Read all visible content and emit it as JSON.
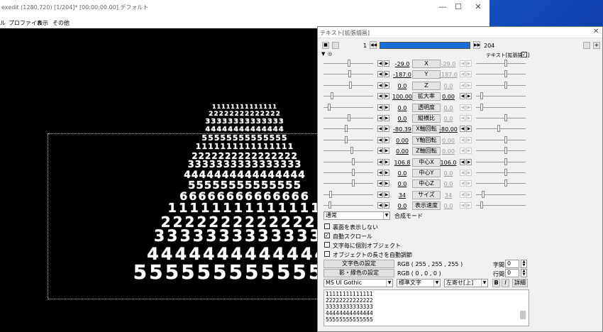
{
  "main_window": {
    "title": "exedit (1280,720)  [1/204]* [00:00:00.00]  デフォルト",
    "menu": [
      "ファイル",
      "プロファイル",
      "表示",
      "その他"
    ],
    "first_menu_partial": "ル",
    "buttons": {
      "minimize": "—",
      "maximize": "☐",
      "close": "✕"
    }
  },
  "preview": {
    "rows": [
      "11111111111111",
      "22222222222222",
      "33333333333333",
      "44444444444444",
      "55555555555555",
      "1111111111111111",
      "2222222222222222",
      "3333333333333333",
      "4444444444444444",
      "55555555555555",
      "66666666666666",
      "11111111111111",
      "22222222222222",
      "33333333333333",
      "44444444444444",
      "55555555555555"
    ]
  },
  "dialog": {
    "title": "テキスト[拡張描画]",
    "frame_start": "1",
    "frame_end": "204",
    "object_label": "テキスト[拡張描画]",
    "object_checked": true,
    "params": [
      {
        "name": "X",
        "left": "-29.0",
        "right": "-29.0",
        "dim": true
      },
      {
        "name": "Y",
        "left": "-187.0",
        "right": "-187.0",
        "dim": true
      },
      {
        "name": "Z",
        "left": "0.0",
        "right": "0.0",
        "dim": true
      },
      {
        "name": "拡大率",
        "left": "100.00",
        "right": "0.00",
        "dim": false
      },
      {
        "name": "透明度",
        "left": "0.0",
        "right": "0.0",
        "dim": true
      },
      {
        "name": "縦横比",
        "left": "0.0",
        "right": "0.0",
        "dim": true
      },
      {
        "name": "X軸回転",
        "left": "-80.39",
        "right": "-80.00",
        "dim": false
      },
      {
        "name": "Y軸回転",
        "left": "0.00",
        "right": "0.00",
        "dim": true
      },
      {
        "name": "Z軸回転",
        "left": "0.00",
        "right": "0.00",
        "dim": true
      },
      {
        "name": "中心X",
        "left": "106.8",
        "right": "106.0",
        "dim": false
      },
      {
        "name": "中心Y",
        "left": "0.0",
        "right": "0.0",
        "dim": true
      },
      {
        "name": "中心Z",
        "left": "0.0",
        "right": "0.0",
        "dim": true
      },
      {
        "name": "サイズ",
        "left": "34",
        "right": "34",
        "dim": true
      },
      {
        "name": "表示速度",
        "left": "0.0",
        "right": "0.0",
        "dim": true
      }
    ],
    "blend_mode": {
      "value": "通常",
      "label": "合成モード"
    },
    "checkboxes": [
      {
        "label": "裏面を表示しない",
        "checked": false
      },
      {
        "label": "自動スクロール",
        "checked": true
      },
      {
        "label": "文字毎に個別オブジェクト",
        "checked": false
      },
      {
        "label": "オブジェクトの長さを自動調節",
        "checked": false
      }
    ],
    "text_color_button": "文字色の設定",
    "text_color_value": "RGB ( 255 , 255 , 255 )",
    "shadow_color_button": "影・縁色の設定",
    "shadow_color_value": "RGB ( 0 , 0 , 0 )",
    "char_spacing_label": "字間",
    "char_spacing_value": "0",
    "line_spacing_label": "行間",
    "line_spacing_value": "0",
    "font": "MS UI Gothic",
    "style": "標準文字",
    "align": "左寄せ[上]",
    "bold": "B",
    "italic": "I",
    "detail_button": "詳細",
    "text_lines": [
      "11111111111111",
      "22222222222222",
      "33333333333333",
      "44444444444444",
      "55555555555555"
    ]
  }
}
